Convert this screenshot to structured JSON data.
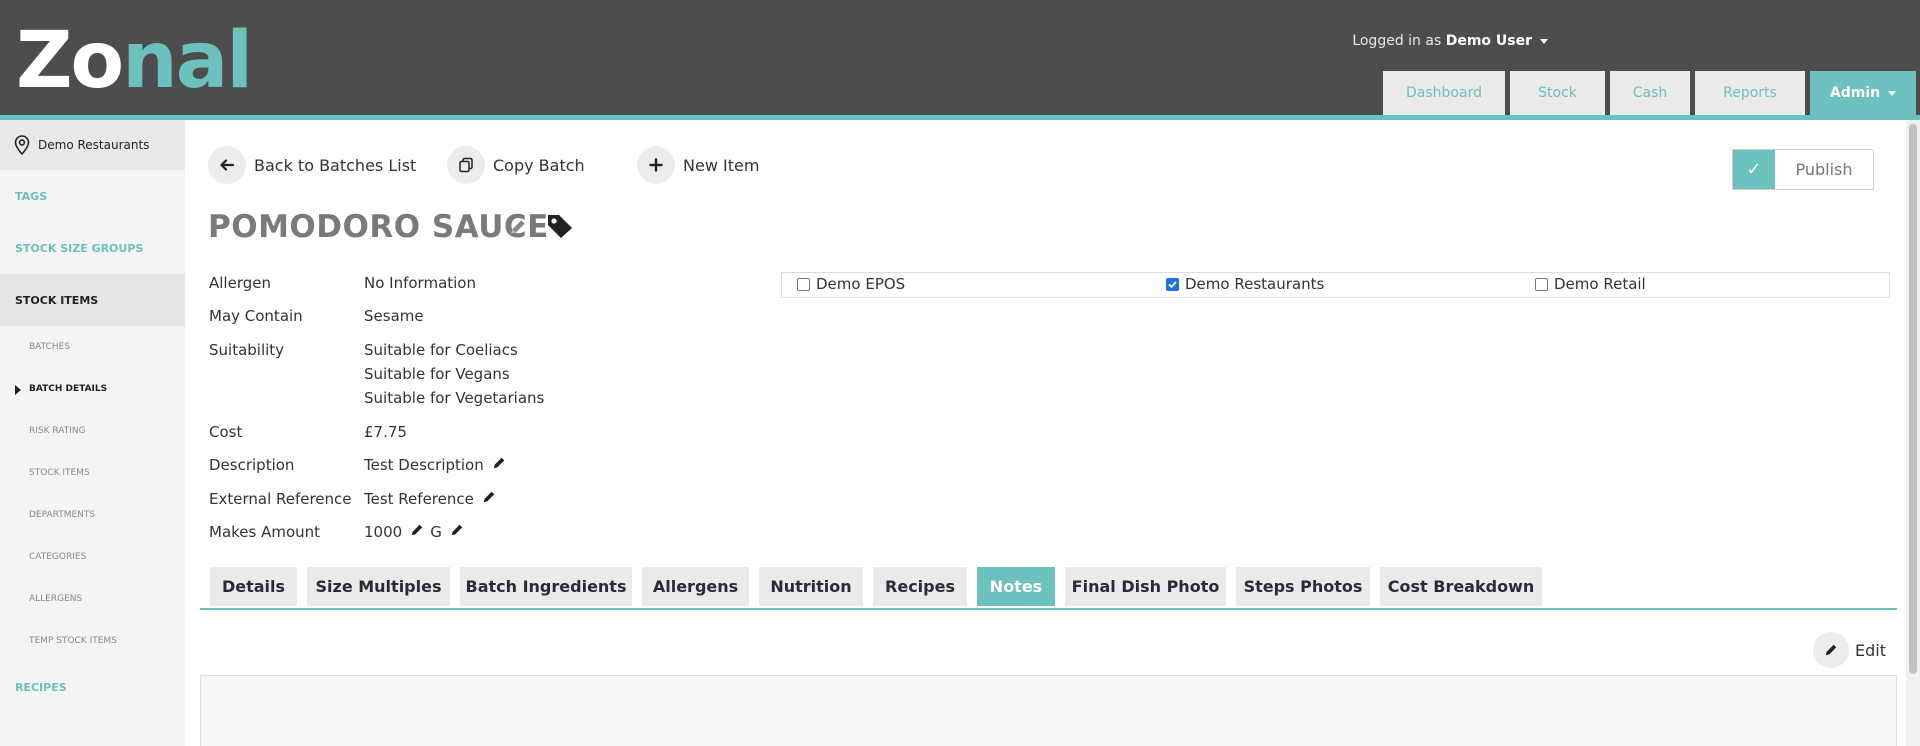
{
  "header": {
    "logo": {
      "part1": "Zo",
      "part2": "nal"
    },
    "logged_in_prefix": "Logged in as",
    "user": "Demo User",
    "nav": [
      {
        "label": "Dashboard"
      },
      {
        "label": "Stock"
      },
      {
        "label": "Cash"
      },
      {
        "label": "Reports"
      },
      {
        "label": "Admin"
      }
    ]
  },
  "sidebar": {
    "location": "Demo Restaurants",
    "sections": {
      "tags": "TAGS",
      "stock_size_groups": "STOCK SIZE GROUPS",
      "stock_items": "STOCK ITEMS",
      "recipes": "RECIPES"
    },
    "sub_items": [
      {
        "label": "BATCHES"
      },
      {
        "label": "BATCH DETAILS"
      },
      {
        "label": "RISK RATING"
      },
      {
        "label": "STOCK ITEMS"
      },
      {
        "label": "DEPARTMENTS"
      },
      {
        "label": "CATEGORIES"
      },
      {
        "label": "ALLERGENS"
      },
      {
        "label": "TEMP STOCK ITEMS"
      }
    ]
  },
  "actions": {
    "back": "Back to Batches List",
    "copy": "Copy Batch",
    "new_item": "New Item",
    "publish": "Publish"
  },
  "item": {
    "title": "POMODORO SAUCE",
    "labels": {
      "allergen": "Allergen",
      "may_contain": "May Contain",
      "suitability": "Suitability",
      "cost": "Cost",
      "description": "Description",
      "external_reference": "External Reference",
      "makes_amount": "Makes Amount"
    },
    "values": {
      "allergen": "No Information",
      "may_contain": "Sesame",
      "suitability": [
        "Suitable for Coeliacs",
        "Suitable for Vegans",
        "Suitable for Vegetarians"
      ],
      "cost": "£7.75",
      "description": "Test Description",
      "external_reference": "Test Reference",
      "makes_amount": "1000",
      "makes_unit": "G"
    }
  },
  "sites": [
    {
      "label": "Demo EPOS",
      "checked": false
    },
    {
      "label": "Demo Restaurants",
      "checked": true
    },
    {
      "label": "Demo Retail",
      "checked": false
    }
  ],
  "tabs": [
    {
      "label": "Details"
    },
    {
      "label": "Size Multiples"
    },
    {
      "label": "Batch Ingredients"
    },
    {
      "label": "Allergens"
    },
    {
      "label": "Nutrition"
    },
    {
      "label": "Recipes"
    },
    {
      "label": "Notes"
    },
    {
      "label": "Final Dish Photo"
    },
    {
      "label": "Steps Photos"
    },
    {
      "label": "Cost Breakdown"
    }
  ],
  "notes": {
    "edit_label": "Edit"
  },
  "colors": {
    "accent": "#6cc0be",
    "header": "#4d4d4d"
  }
}
